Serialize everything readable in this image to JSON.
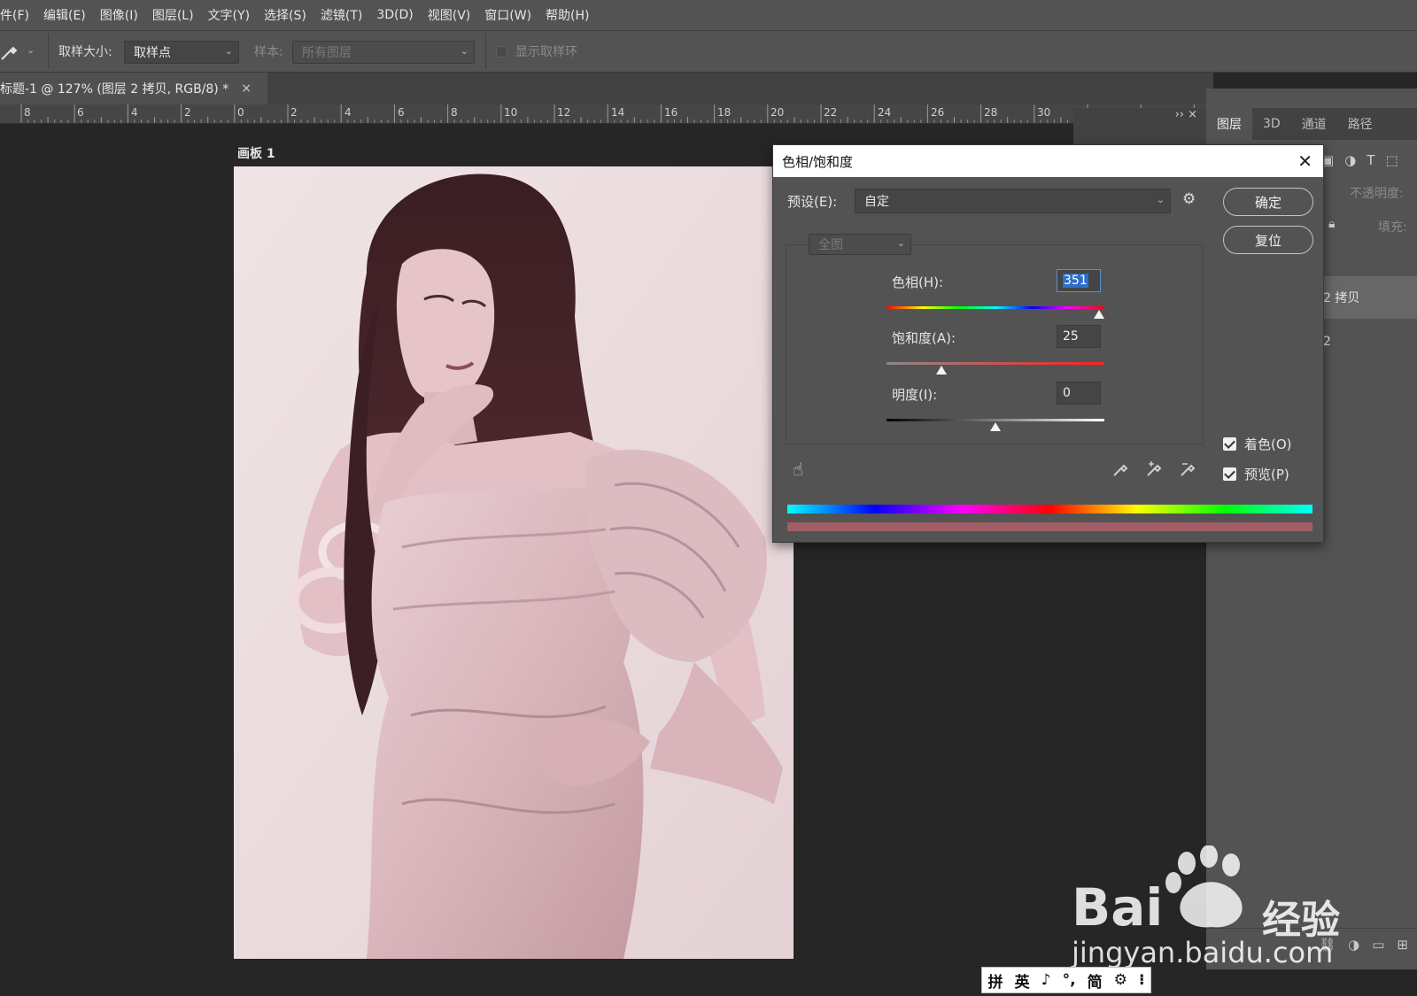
{
  "menubar": {
    "items": [
      "件(F)",
      "编辑(E)",
      "图像(I)",
      "图层(L)",
      "文字(Y)",
      "选择(S)",
      "滤镜(T)",
      "3D(D)",
      "视图(V)",
      "窗口(W)",
      "帮助(H)"
    ]
  },
  "options": {
    "sample_size_label": "取样大小:",
    "sample_size_value": "取样点",
    "sample_label": "样本:",
    "sample_value": "所有图层",
    "show_ring_label": "显示取样环"
  },
  "document": {
    "tab_title": "标题-1 @ 127% (图层 2 拷贝, RGB/8) *",
    "close": "×",
    "artboard_label": "画板 1"
  },
  "ruler": {
    "labels": [
      "8",
      "6",
      "4",
      "2",
      "0",
      "2",
      "4",
      "6",
      "8",
      "10",
      "12",
      "14",
      "16",
      "18",
      "20",
      "22",
      "24",
      "26",
      "28",
      "30"
    ]
  },
  "panel": {
    "tabs": [
      "图层",
      "3D",
      "通道",
      "路径"
    ],
    "opacity_label": "不透明度:",
    "fill_label": "填充:",
    "layers": [
      "2 拷贝",
      "2"
    ],
    "collapse_icons": "›› ×"
  },
  "dialog": {
    "title": "色相/饱和度",
    "close": "✕",
    "preset_label": "预设(E):",
    "preset_value": "自定",
    "ok_label": "确定",
    "reset_label": "复位",
    "channel_value": "全图",
    "hue_label": "色相(H):",
    "hue_value": "351",
    "saturation_label": "饱和度(A):",
    "saturation_value": "25",
    "lightness_label": "明度(I):",
    "lightness_value": "0",
    "colorize_label": "着色(O)",
    "preview_label": "预览(P)",
    "colorize_checked": true,
    "preview_checked": true,
    "hue_fraction": 0.975,
    "saturation_fraction": 0.25,
    "lightness_fraction": 0.5,
    "tint_color": "#a15d66"
  },
  "watermark": {
    "brand": "Bai",
    "brand2": "经验",
    "url": "jingyan.baidu.com"
  },
  "ime": {
    "items": [
      "拼",
      "英",
      "♪",
      "°,",
      "简",
      "⚙",
      "⁝"
    ]
  }
}
